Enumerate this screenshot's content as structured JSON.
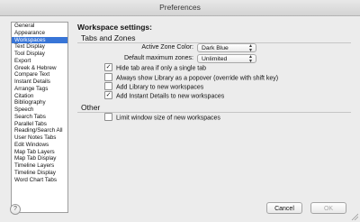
{
  "window": {
    "title": "Preferences"
  },
  "sidebar": {
    "items": [
      "General",
      "Appearance",
      "Workspaces",
      "Text Display",
      "Tool Display",
      "Export",
      "Greek & Hebrew",
      "Compare Text",
      "Instant Details",
      "Arrange Tags",
      "Citation",
      "Bibliography",
      "Speech",
      "Search Tabs",
      "Parallel Tabs",
      "Reading/Search All",
      "User Notes Tabs",
      "Edit Windows",
      "Map Tab Layers",
      "Map Tab Display",
      "Timeline Layers",
      "Timeline Display",
      "Word Chart Tabs"
    ],
    "selected": "Workspaces"
  },
  "main": {
    "title": "Workspace settings:",
    "tabs_section": {
      "label": "Tabs and Zones",
      "zone_color_label": "Active Zone Color:",
      "zone_color_value": "Dark Blue",
      "max_zones_label": "Default maximum zones:",
      "max_zones_value": "Unlimited",
      "checkboxes": [
        {
          "label": "Hide tab area if only a single tab",
          "checked": true
        },
        {
          "label": "Always show Library as a popover (override with shift key)",
          "checked": false
        },
        {
          "label": "Add Library to new workspaces",
          "checked": false
        },
        {
          "label": "Add Instant Details to new workspaces",
          "checked": true
        }
      ]
    },
    "other_section": {
      "label": "Other",
      "checkboxes": [
        {
          "label": "Limit window size of new workspaces",
          "checked": false
        }
      ]
    }
  },
  "footer": {
    "help_label": "?",
    "cancel_label": "Cancel",
    "ok_label": "OK"
  },
  "icons": {
    "checkmark": "✓",
    "select_arrows": "▲▼"
  }
}
